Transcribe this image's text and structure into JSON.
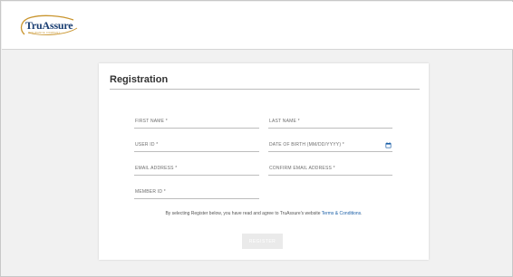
{
  "header": {
    "logo_text": "TruAssure",
    "logo_subtext": "INSURANCE COMPANY",
    "colors": {
      "navy": "#1b3f73",
      "gold": "#c9952e"
    }
  },
  "registration": {
    "title": "Registration",
    "fields": {
      "first_name": {
        "label": "FIRST NAME *",
        "value": ""
      },
      "last_name": {
        "label": "LAST NAME *",
        "value": ""
      },
      "user_id": {
        "label": "USER ID *",
        "value": ""
      },
      "date_of_birth": {
        "label": "DATE OF BIRTH (MM/DD/YYYY) *",
        "value": "",
        "icon": "calendar-icon"
      },
      "email": {
        "label": "EMAIL ADDRESS *",
        "value": ""
      },
      "confirm_email": {
        "label": "CONFIRM EMAIL ADDRESS *",
        "value": ""
      },
      "member_id": {
        "label": "MEMBER ID *",
        "value": ""
      }
    },
    "agreement_text": "By selecting Register below, you have read and agree to TruAssure's website ",
    "terms_link": "Terms & Conditions",
    "agreement_end": ".",
    "register_label": "REGISTER",
    "link_color": "#1b5fa7"
  }
}
